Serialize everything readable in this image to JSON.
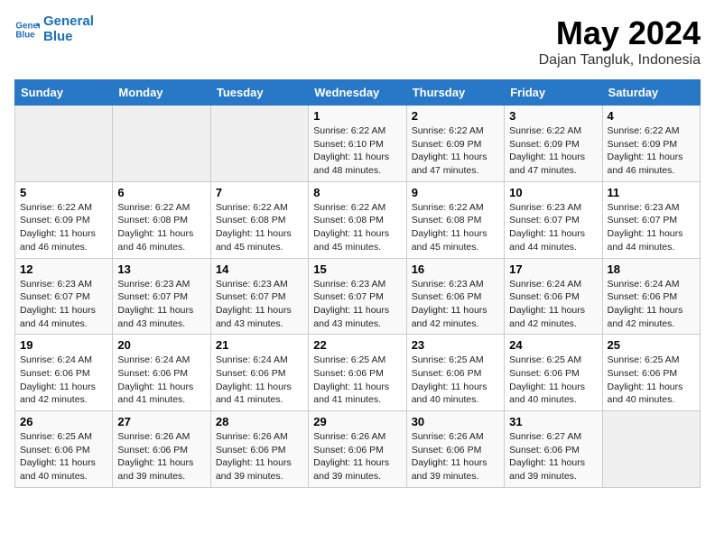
{
  "logo": {
    "line1": "General",
    "line2": "Blue"
  },
  "title": "May 2024",
  "subtitle": "Dajan Tangluk, Indonesia",
  "days_of_week": [
    "Sunday",
    "Monday",
    "Tuesday",
    "Wednesday",
    "Thursday",
    "Friday",
    "Saturday"
  ],
  "weeks": [
    [
      {
        "day": "",
        "info": ""
      },
      {
        "day": "",
        "info": ""
      },
      {
        "day": "",
        "info": ""
      },
      {
        "day": "1",
        "info": "Sunrise: 6:22 AM\nSunset: 6:10 PM\nDaylight: 11 hours and 48 minutes."
      },
      {
        "day": "2",
        "info": "Sunrise: 6:22 AM\nSunset: 6:09 PM\nDaylight: 11 hours and 47 minutes."
      },
      {
        "day": "3",
        "info": "Sunrise: 6:22 AM\nSunset: 6:09 PM\nDaylight: 11 hours and 47 minutes."
      },
      {
        "day": "4",
        "info": "Sunrise: 6:22 AM\nSunset: 6:09 PM\nDaylight: 11 hours and 46 minutes."
      }
    ],
    [
      {
        "day": "5",
        "info": "Sunrise: 6:22 AM\nSunset: 6:09 PM\nDaylight: 11 hours and 46 minutes."
      },
      {
        "day": "6",
        "info": "Sunrise: 6:22 AM\nSunset: 6:08 PM\nDaylight: 11 hours and 46 minutes."
      },
      {
        "day": "7",
        "info": "Sunrise: 6:22 AM\nSunset: 6:08 PM\nDaylight: 11 hours and 45 minutes."
      },
      {
        "day": "8",
        "info": "Sunrise: 6:22 AM\nSunset: 6:08 PM\nDaylight: 11 hours and 45 minutes."
      },
      {
        "day": "9",
        "info": "Sunrise: 6:22 AM\nSunset: 6:08 PM\nDaylight: 11 hours and 45 minutes."
      },
      {
        "day": "10",
        "info": "Sunrise: 6:23 AM\nSunset: 6:07 PM\nDaylight: 11 hours and 44 minutes."
      },
      {
        "day": "11",
        "info": "Sunrise: 6:23 AM\nSunset: 6:07 PM\nDaylight: 11 hours and 44 minutes."
      }
    ],
    [
      {
        "day": "12",
        "info": "Sunrise: 6:23 AM\nSunset: 6:07 PM\nDaylight: 11 hours and 44 minutes."
      },
      {
        "day": "13",
        "info": "Sunrise: 6:23 AM\nSunset: 6:07 PM\nDaylight: 11 hours and 43 minutes."
      },
      {
        "day": "14",
        "info": "Sunrise: 6:23 AM\nSunset: 6:07 PM\nDaylight: 11 hours and 43 minutes."
      },
      {
        "day": "15",
        "info": "Sunrise: 6:23 AM\nSunset: 6:07 PM\nDaylight: 11 hours and 43 minutes."
      },
      {
        "day": "16",
        "info": "Sunrise: 6:23 AM\nSunset: 6:06 PM\nDaylight: 11 hours and 42 minutes."
      },
      {
        "day": "17",
        "info": "Sunrise: 6:24 AM\nSunset: 6:06 PM\nDaylight: 11 hours and 42 minutes."
      },
      {
        "day": "18",
        "info": "Sunrise: 6:24 AM\nSunset: 6:06 PM\nDaylight: 11 hours and 42 minutes."
      }
    ],
    [
      {
        "day": "19",
        "info": "Sunrise: 6:24 AM\nSunset: 6:06 PM\nDaylight: 11 hours and 42 minutes."
      },
      {
        "day": "20",
        "info": "Sunrise: 6:24 AM\nSunset: 6:06 PM\nDaylight: 11 hours and 41 minutes."
      },
      {
        "day": "21",
        "info": "Sunrise: 6:24 AM\nSunset: 6:06 PM\nDaylight: 11 hours and 41 minutes."
      },
      {
        "day": "22",
        "info": "Sunrise: 6:25 AM\nSunset: 6:06 PM\nDaylight: 11 hours and 41 minutes."
      },
      {
        "day": "23",
        "info": "Sunrise: 6:25 AM\nSunset: 6:06 PM\nDaylight: 11 hours and 40 minutes."
      },
      {
        "day": "24",
        "info": "Sunrise: 6:25 AM\nSunset: 6:06 PM\nDaylight: 11 hours and 40 minutes."
      },
      {
        "day": "25",
        "info": "Sunrise: 6:25 AM\nSunset: 6:06 PM\nDaylight: 11 hours and 40 minutes."
      }
    ],
    [
      {
        "day": "26",
        "info": "Sunrise: 6:25 AM\nSunset: 6:06 PM\nDaylight: 11 hours and 40 minutes."
      },
      {
        "day": "27",
        "info": "Sunrise: 6:26 AM\nSunset: 6:06 PM\nDaylight: 11 hours and 39 minutes."
      },
      {
        "day": "28",
        "info": "Sunrise: 6:26 AM\nSunset: 6:06 PM\nDaylight: 11 hours and 39 minutes."
      },
      {
        "day": "29",
        "info": "Sunrise: 6:26 AM\nSunset: 6:06 PM\nDaylight: 11 hours and 39 minutes."
      },
      {
        "day": "30",
        "info": "Sunrise: 6:26 AM\nSunset: 6:06 PM\nDaylight: 11 hours and 39 minutes."
      },
      {
        "day": "31",
        "info": "Sunrise: 6:27 AM\nSunset: 6:06 PM\nDaylight: 11 hours and 39 minutes."
      },
      {
        "day": "",
        "info": ""
      }
    ]
  ]
}
